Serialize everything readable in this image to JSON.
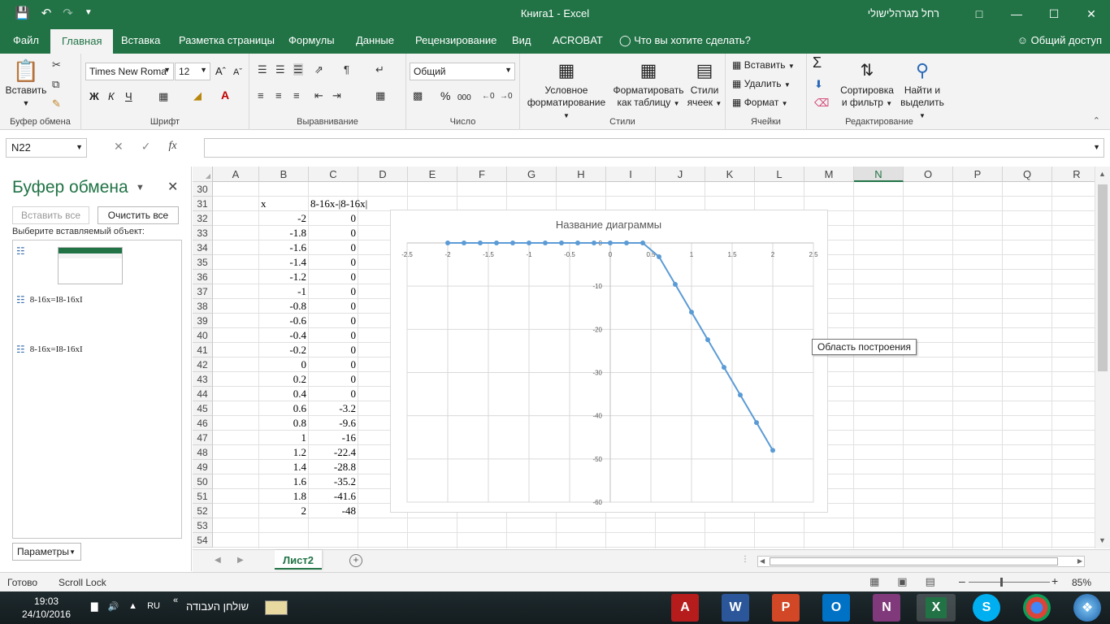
{
  "titlebar": {
    "title": "Книга1  -  Excel",
    "user": "רחל מגרהלישולי",
    "qat_icons": [
      "save-icon",
      "undo-icon",
      "redo-icon",
      "customize-icon"
    ]
  },
  "tabs": {
    "file": "Файл",
    "home": "Главная",
    "insert": "Вставка",
    "layout": "Разметка страницы",
    "formulas": "Формулы",
    "data": "Данные",
    "review": "Рецензирование",
    "view": "Вид",
    "acrobat": "ACROBAT",
    "tellme": "Что вы хотите сделать?",
    "share": "Общий доступ"
  },
  "ribbon": {
    "clipboard": {
      "label": "Буфер обмена",
      "paste": "Вставить"
    },
    "font": {
      "label": "Шрифт",
      "name": "Times New Roma",
      "size": "12",
      "bold": "Ж",
      "italic": "К",
      "underline": "Ч"
    },
    "alignment": {
      "label": "Выравнивание"
    },
    "number": {
      "label": "Число",
      "format": "Общий",
      "percent": "%",
      "thousands": "000"
    },
    "styles": {
      "label": "Стили",
      "cond_l1": "Условное",
      "cond_l2": "форматирование",
      "table_l1": "Форматировать",
      "table_l2": "как таблицу",
      "cell_l1": "Стили",
      "cell_l2": "ячеек"
    },
    "cells": {
      "label": "Ячейки",
      "insert": "Вставить",
      "delete": "Удалить",
      "format": "Формат"
    },
    "editing": {
      "label": "Редактирование",
      "sort_l1": "Сортировка",
      "sort_l2": "и фильтр",
      "find_l1": "Найти и",
      "find_l2": "выделить"
    }
  },
  "formula_bar": {
    "name_box": "N22",
    "fx": "fx",
    "value": ""
  },
  "clipboard_pane": {
    "title": "Буфер обмена",
    "paste_all": "Вставить все",
    "clear_all": "Очистить все",
    "select_label": "Выберите вставляемый объект:",
    "items": [
      "8-16x=І8-16xІ",
      "8-16x=І8-16xІ"
    ],
    "options": "Параметры"
  },
  "grid": {
    "columns": [
      "A",
      "B",
      "C",
      "D",
      "E",
      "F",
      "G",
      "H",
      "I",
      "J",
      "K",
      "L",
      "M",
      "N",
      "O",
      "P",
      "Q",
      "R"
    ],
    "selected_column": "N",
    "rows": [
      30,
      31,
      32,
      33,
      34,
      35,
      36,
      37,
      38,
      39,
      40,
      41,
      42,
      43,
      44,
      45,
      46,
      47,
      48,
      49,
      50,
      51,
      52,
      53,
      54
    ],
    "header_b": "x",
    "header_c": "8-16x-|8-16x|",
    "col_b": [
      "-2",
      "-1.8",
      "-1.6",
      "-1.4",
      "-1.2",
      "-1",
      "-0.8",
      "-0.6",
      "-0.4",
      "-0.2",
      "0",
      "0.2",
      "0.4",
      "0.6",
      "0.8",
      "1",
      "1.2",
      "1.4",
      "1.6",
      "1.8",
      "2"
    ],
    "col_c": [
      "0",
      "0",
      "0",
      "0",
      "0",
      "0",
      "0",
      "0",
      "0",
      "0",
      "0",
      "0",
      "0",
      "-3.2",
      "-9.6",
      "-16",
      "-22.4",
      "-28.8",
      "-35.2",
      "-41.6",
      "-48"
    ]
  },
  "chart_data": {
    "type": "line",
    "title": "Название диаграммы",
    "xlabel": "",
    "ylabel": "",
    "xlim": [
      -2.5,
      2.5
    ],
    "ylim": [
      -60,
      0
    ],
    "x_ticks": [
      "-2.5",
      "-2",
      "-1.5",
      "-1",
      "-0.5",
      "0",
      "0.5",
      "1",
      "1.5",
      "2",
      "2.5"
    ],
    "y_ticks": [
      "0",
      "-10",
      "-20",
      "-30",
      "-40",
      "-50",
      "-60"
    ],
    "grid": true,
    "legend": "none",
    "color": "#5b9bd5",
    "series": [
      {
        "x": [
          -2,
          -1.8,
          -1.6,
          -1.4,
          -1.2,
          -1,
          -0.8,
          -0.6,
          -0.4,
          -0.2,
          0,
          0.2,
          0.4,
          0.6,
          0.8,
          1,
          1.2,
          1.4,
          1.6,
          1.8,
          2
        ],
        "y": [
          0,
          0,
          0,
          0,
          0,
          0,
          0,
          0,
          0,
          0,
          0,
          0,
          0,
          -3.2,
          -9.6,
          -16,
          -22.4,
          -28.8,
          -35.2,
          -41.6,
          -48
        ]
      }
    ]
  },
  "chart_tooltip": "Область построения",
  "sheets": {
    "active": "Лист2"
  },
  "statusbar": {
    "ready": "Готово",
    "scroll_lock": "Scroll Lock",
    "zoom": "85%"
  },
  "taskbar": {
    "time": "19:03",
    "date": "24/10/2016",
    "lang": "RU",
    "desktop": "שולחן העבודה"
  },
  "colors": {
    "excel_green": "#217346",
    "series": "#5b9bd5"
  }
}
